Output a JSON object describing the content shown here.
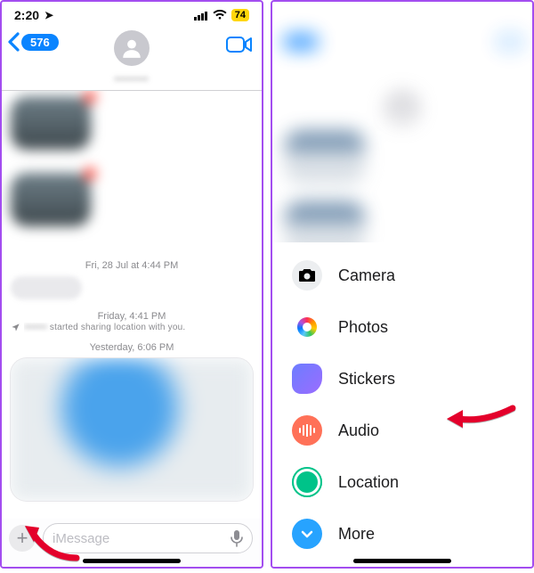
{
  "left": {
    "status": {
      "time": "2:20",
      "battery": "74"
    },
    "backCount": "576",
    "contactName": "••••••••",
    "ts1": "Fri, 28 Jul at 4:44 PM",
    "ts2": "Friday, 4:41 PM",
    "sharingBlur": "•••••••",
    "sharingText": " started sharing location with you.",
    "ts3": "Yesterday, 6:06 PM",
    "placeholder": "iMessage"
  },
  "menu": {
    "camera": "Camera",
    "photos": "Photos",
    "stickers": "Stickers",
    "audio": "Audio",
    "location": "Location",
    "more": "More"
  }
}
